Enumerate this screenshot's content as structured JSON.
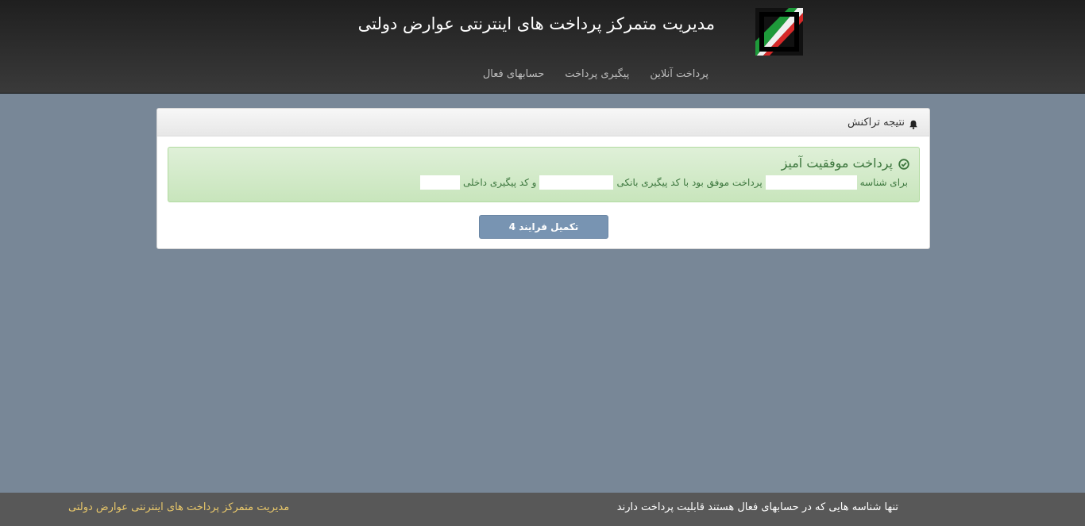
{
  "header": {
    "title": "مدیریت متمرکز پرداخت های اینترنتی عوارض دولتی",
    "logo_icon": "stripe-logo-icon"
  },
  "nav": {
    "items": [
      {
        "label": "پرداخت آنلاین"
      },
      {
        "label": "پیگیری پرداخت"
      },
      {
        "label": "حسابهای فعال"
      }
    ]
  },
  "panel": {
    "heading": "نتیجه تراکنش",
    "heading_icon": "bell-icon",
    "alert": {
      "title": "پرداخت موفقیت آمیز",
      "title_icon": "check-circle-icon",
      "part1": "برای شناسه",
      "part2": "پرداخت موفق بود با کد پیگیری بانکی",
      "part3": "و کد پیگیری داخلی"
    },
    "button_label": "تکمیل فرایند 4"
  },
  "footer": {
    "note": "تنها شناسه هایی که در حسابهای فعال هستند قابلیت پرداخت دارند",
    "brand": "مدیریت متمرکز پرداخت های اینترنتی عوارض دولتی"
  },
  "colors": {
    "header_bg": "#2b2b2b",
    "page_bg": "#788797",
    "success_text": "#3c763d",
    "success_bg": "#dff0d8",
    "button_bg": "#7894b2",
    "footer_bg": "#585858",
    "footer_brand": "#e8c76a"
  }
}
